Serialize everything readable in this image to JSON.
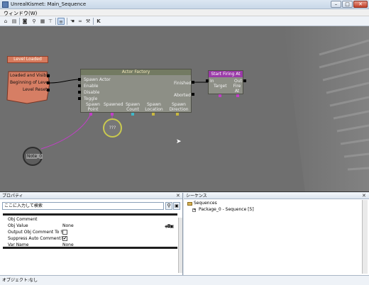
{
  "window": {
    "title": "UnrealKismet: Main_Sequence"
  },
  "menu": {
    "items": [
      "ウィンドウ(W)"
    ]
  },
  "toolbar": {
    "icons": [
      "open-icon",
      "parent-sequence-icon",
      "camera-icon",
      "search-icon",
      "search-class-icon",
      "tree-icon",
      "comment-icon",
      "hand-icon",
      "link-icon",
      "wrench-icon",
      "k-icon"
    ]
  },
  "canvas": {
    "event_node": {
      "title": "Level Loaded",
      "outputs": [
        "Loaded and Visible",
        "Beginning of Level",
        "Level Reset"
      ]
    },
    "actor_factory": {
      "title": "Actor Factory",
      "inputs": [
        "Spawn Actor",
        "Enable",
        "Disable",
        "Toggle"
      ],
      "outputs": [
        "Finished",
        "Aborted"
      ],
      "vars": [
        "Spawn Point",
        "Spawned",
        "Spawn Count",
        "Spawn Location",
        "Spawn Direction"
      ]
    },
    "start_firing": {
      "title": "Start Firing At",
      "in_label": "In",
      "out_label": "Out",
      "vars": [
        "Target",
        "Fire At"
      ]
    },
    "var_node": {
      "label": "???"
    },
    "note_node": {
      "label": "Note_0"
    }
  },
  "properties": {
    "title": "プロパティ",
    "search_placeholder": "ここに入力して検索",
    "rows": [
      {
        "name": "Obj Comment",
        "value": ""
      },
      {
        "name": "Obj Value",
        "value": "None"
      },
      {
        "name": "Output Obj Comment To S",
        "value": ""
      },
      {
        "name": "Suppress Auto Comment?",
        "value": ""
      },
      {
        "name": "Var Name",
        "value": "None"
      }
    ],
    "checkbox_states": [
      false,
      true
    ]
  },
  "sequences": {
    "title": "シーケンス",
    "root": "Sequences",
    "child": "Package_0 - Sequence [5]"
  },
  "status": {
    "text": "オブジェクト:なし"
  },
  "colors": {
    "canvas": "#6f6f6f",
    "event_header": "#d77b5e",
    "factory_header": "#737a62",
    "firing_header": "#9a3aa8",
    "wire_exec": "#000000",
    "wire_object": "#c23fc7"
  }
}
